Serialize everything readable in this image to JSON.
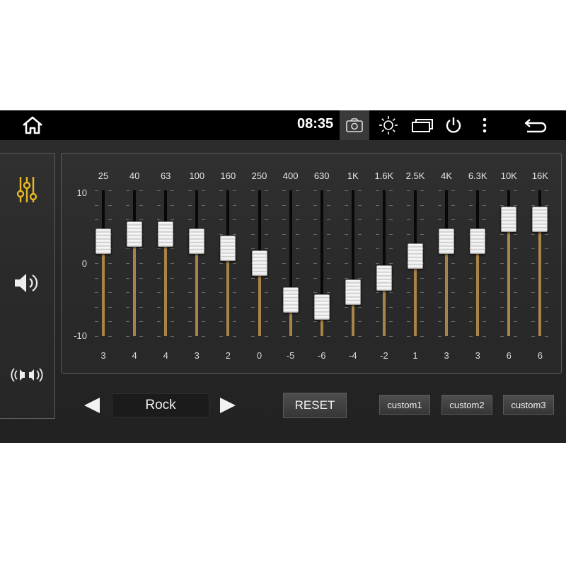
{
  "status_bar": {
    "time": "08:35",
    "icons": [
      "home-icon",
      "camera-icon",
      "brightness-icon",
      "window-icon",
      "power-icon",
      "more-vertical-icon",
      "back-icon"
    ]
  },
  "side_menu": [
    {
      "name": "equalizer",
      "icon": "equalizer-sliders-icon",
      "active": true
    },
    {
      "name": "volume",
      "icon": "speaker-icon",
      "active": false
    },
    {
      "name": "balance",
      "icon": "surround-balance-icon",
      "active": false
    }
  ],
  "equalizer": {
    "axis": {
      "max_label": "10",
      "mid_label": "0",
      "min_label": "-10",
      "min": -10,
      "max": 10
    },
    "bands": [
      {
        "freq": "25",
        "value": 3
      },
      {
        "freq": "40",
        "value": 4
      },
      {
        "freq": "63",
        "value": 4
      },
      {
        "freq": "100",
        "value": 3
      },
      {
        "freq": "160",
        "value": 2
      },
      {
        "freq": "250",
        "value": 0
      },
      {
        "freq": "400",
        "value": -5
      },
      {
        "freq": "630",
        "value": -6
      },
      {
        "freq": "1K",
        "value": -4
      },
      {
        "freq": "1.6K",
        "value": -2
      },
      {
        "freq": "2.5K",
        "value": 1
      },
      {
        "freq": "4K",
        "value": 3
      },
      {
        "freq": "6.3K",
        "value": 3
      },
      {
        "freq": "10K",
        "value": 6
      },
      {
        "freq": "16K",
        "value": 6
      }
    ]
  },
  "controls": {
    "preset": "Rock",
    "reset_label": "RESET",
    "custom1_label": "custom1",
    "custom2_label": "custom2",
    "custom3_label": "custom3"
  },
  "colors": {
    "accent": "#e8b923",
    "track_fill": "#a88449",
    "background": "#2a2a2a"
  }
}
